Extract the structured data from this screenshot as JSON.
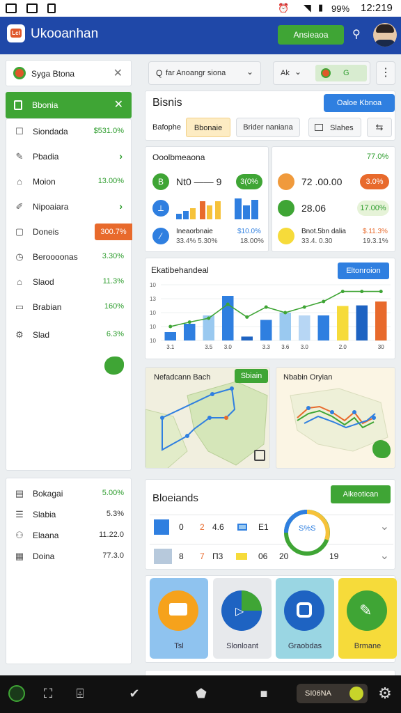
{
  "status": {
    "battery": "99%",
    "time": "12:219"
  },
  "appbar": {
    "title": "Ukooanhan",
    "logo_text": "Lcl",
    "action_label": "Ansieaoa"
  },
  "left": {
    "search_label": "Syga Btona",
    "chip_label": "Bbonia",
    "items": [
      {
        "icon": "square-icon",
        "label": "Siondada",
        "value": "$531.0%",
        "type": "value"
      },
      {
        "icon": "pencil-icon",
        "label": "Pbadia",
        "value": "",
        "type": "chevron"
      },
      {
        "icon": "home-icon",
        "label": "Moion",
        "value": "13.00%",
        "type": "value"
      },
      {
        "icon": "edit-icon",
        "label": "Nipoaiara",
        "value": "",
        "type": "chevron"
      },
      {
        "icon": "doc-icon",
        "label": "Doneis",
        "value": "300.7%",
        "type": "badge"
      },
      {
        "icon": "clock-icon",
        "label": "Beroooonas",
        "value": "3.30%",
        "type": "value"
      },
      {
        "icon": "tag-icon",
        "label": "Slaod",
        "value": "11.3%",
        "type": "value"
      },
      {
        "icon": "chart-icon",
        "label": "Brabian",
        "value": "160%",
        "type": "value"
      },
      {
        "icon": "gear-icon",
        "label": "Slad",
        "value": "6.3%",
        "type": "value"
      }
    ],
    "items2": [
      {
        "icon": "receipt-icon",
        "label": "Bokagai",
        "value": "5.00%"
      },
      {
        "icon": "list-icon",
        "label": "Slabia",
        "value": "5.3%"
      },
      {
        "icon": "people-icon",
        "label": "Elaana",
        "value": "11.22.0"
      },
      {
        "icon": "grid-icon",
        "label": "Doina",
        "value": "77.3.0"
      }
    ]
  },
  "toolbar": {
    "search_label": "far Anoangr siona",
    "toggle_label": "Ak",
    "toggle_value": "G"
  },
  "business": {
    "title": "Bisnis",
    "action_label": "Oaloe Kbnoa",
    "tabs": [
      "Bafophe",
      "Bbonaie",
      "Brider naniana"
    ],
    "filter_label": "Slahes"
  },
  "kpi_left": {
    "title": "Ooolbmeaona",
    "row1_value": "Nt0 —— 9",
    "row1_badge": "3(0%",
    "row3_title": "Ineaorbnaie",
    "row3_sub": "33.4% 5.30%",
    "row3_value": "$10.0%",
    "row3_value2": "18.00%"
  },
  "kpi_right": {
    "top_value": "77.0%",
    "row1_value": "72 .00.00",
    "row1_badge": "3.0%",
    "row2_value": "28.06",
    "row2_badge": "17.00%",
    "row3_title": "Bnot.5bn dalia",
    "row3_sub": "33.4. 0.30",
    "row3_value": "$.11.3%",
    "row3_value2": "19.3.1%"
  },
  "chart_data": {
    "type": "bar",
    "title": "Ekatibehandeal",
    "action_label": "Eltonroion",
    "categories": [
      "3.1",
      "",
      "3.5",
      "3.0",
      "",
      "3.3",
      "3.6",
      "3.0",
      "",
      "2.0",
      "",
      "30"
    ],
    "y_ticks": [
      "10",
      "13",
      "10",
      "10",
      "10"
    ],
    "series": [
      {
        "values": [
          1.5,
          3.0,
          4.5,
          8.0,
          0.7,
          3.7,
          5.0,
          4.5,
          4.5,
          6.2,
          6.3,
          7.0
        ]
      },
      {
        "values": [
          2.5,
          3.3,
          4.0,
          6.5,
          4.2,
          6.0,
          5.0,
          6.0,
          7.0,
          8.8,
          8.8,
          8.8
        ]
      }
    ],
    "ylim": [
      0,
      10
    ]
  },
  "maps": {
    "left_title": "Nefadcann Bach",
    "left_badge": "Sbiain",
    "right_title": "Nbabin Oryian"
  },
  "stock": {
    "title": "Bloeiands",
    "action_label": "Aikeotican",
    "donut_label": "S%S",
    "row1": [
      "0",
      "2",
      "4.6",
      "",
      "E1"
    ],
    "row2": [
      "8",
      "7",
      "Π3",
      "",
      "06",
      "20",
      "19"
    ]
  },
  "tiles": [
    {
      "label": "Tsl",
      "color": "#8fc3ef"
    },
    {
      "label": "Slonloant",
      "color": "#e7e9ec"
    },
    {
      "label": "Graobdas",
      "color": "#9ad6e3"
    },
    {
      "label": "Brmane",
      "color": "#f6db3a"
    }
  ],
  "footer": {
    "chip_label": "SI06NA"
  },
  "colors": {
    "primary": "#1f48a8",
    "accent_green": "#3fa535",
    "orange": "#e86a2c",
    "blue_btn": "#2f7fe0"
  }
}
